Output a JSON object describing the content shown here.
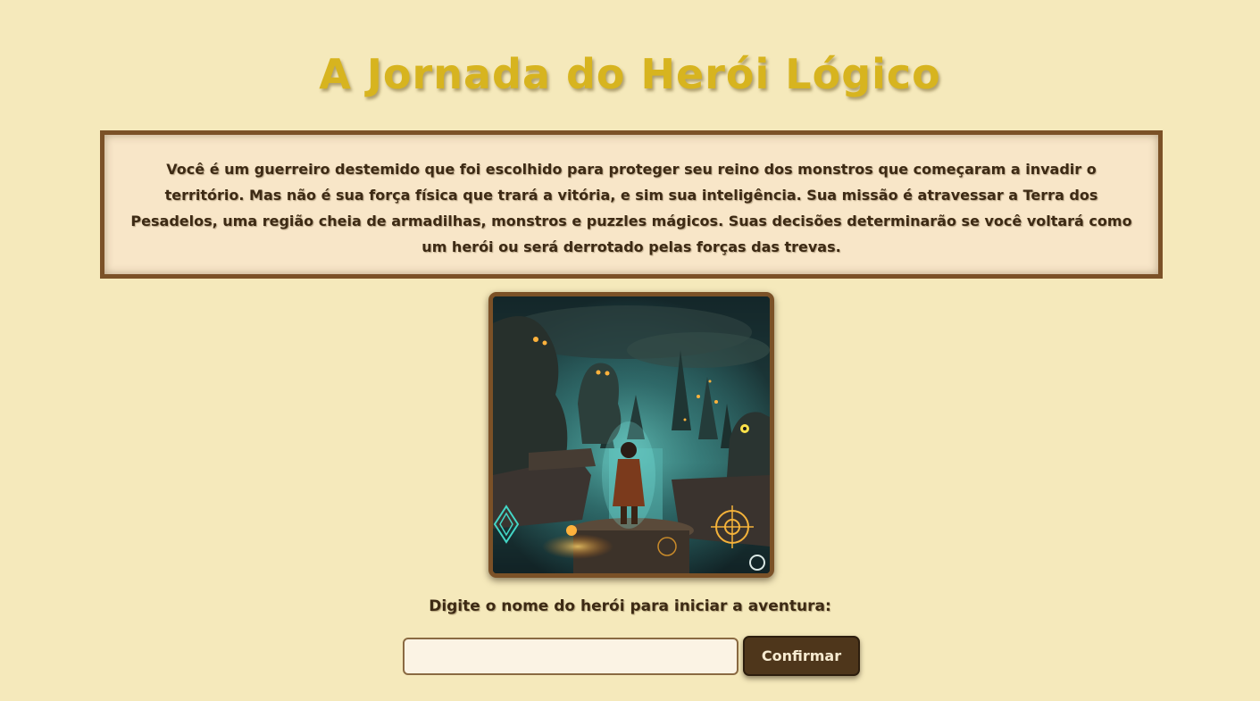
{
  "page": {
    "title": "A Jornada do Herói Lógico"
  },
  "story": {
    "text": "Você é um guerreiro destemido que foi escolhido para proteger seu reino dos monstros que começaram a invadir o território. Mas não é sua força física que trará a vitória, e sim sua inteligência. Sua missão é atravessar a Terra dos Pesadelos, uma região cheia de armadilhas, monstros e puzzles mágicos. Suas decisões determinarão se você voltará como um herói ou será derrotado pelas forças das trevas."
  },
  "illustration": {
    "subject": "hero-facing-nightmare-land"
  },
  "form": {
    "prompt_label": "Digite o nome do herói para iniciar a aventura:",
    "name_input_value": "",
    "name_input_placeholder": "",
    "confirm_label": "Confirmar"
  },
  "colors": {
    "background": "#f5e9bb",
    "title": "#d7b41f",
    "border": "#7b5127",
    "box_background": "#f8e6c8",
    "text": "#3d2a14",
    "button_background": "#4e361b",
    "button_text": "#f6ead0"
  }
}
